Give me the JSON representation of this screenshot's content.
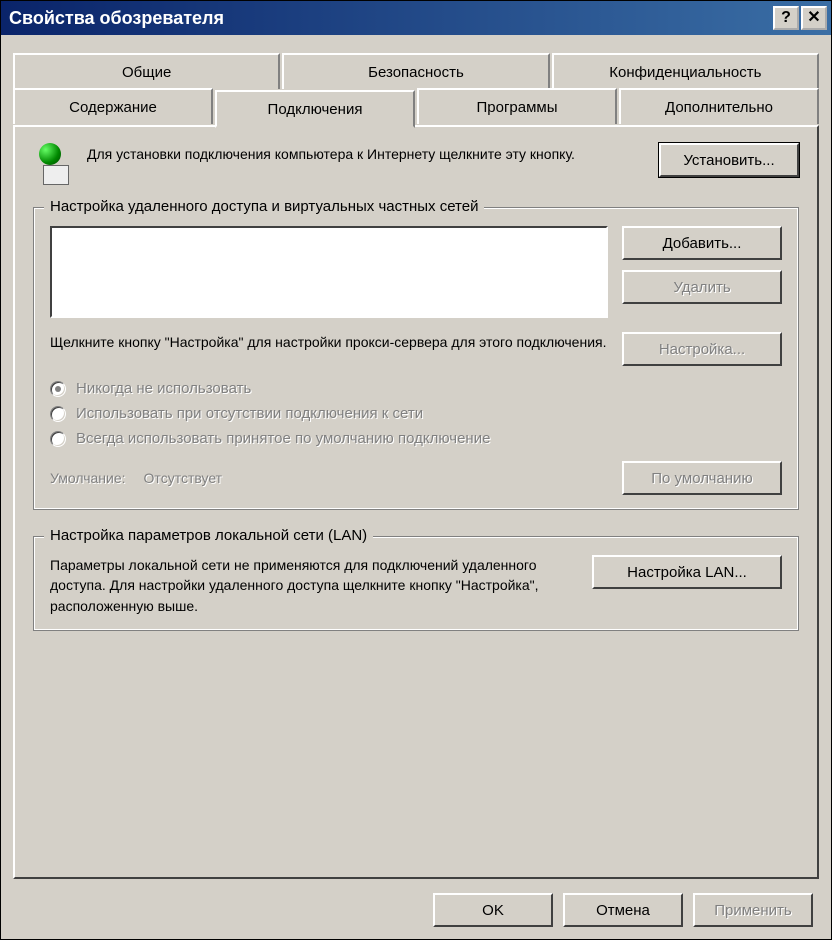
{
  "window": {
    "title": "Свойства обозревателя"
  },
  "tabs": {
    "row1": [
      {
        "id": "general",
        "label": "Общие"
      },
      {
        "id": "security",
        "label": "Безопасность"
      },
      {
        "id": "privacy",
        "label": "Конфиденциальность"
      }
    ],
    "row2": [
      {
        "id": "content",
        "label": "Содержание"
      },
      {
        "id": "connections",
        "label": "Подключения",
        "active": true
      },
      {
        "id": "programs",
        "label": "Программы"
      },
      {
        "id": "advanced",
        "label": "Дополнительно"
      }
    ]
  },
  "setup": {
    "text": "Для установки подключения компьютера к Интернету щелкните эту кнопку.",
    "button": "Установить..."
  },
  "dialup_group": {
    "legend": "Настройка удаленного доступа и виртуальных частных сетей",
    "add_btn": "Добавить...",
    "remove_btn": "Удалить",
    "settings_btn": "Настройка...",
    "hint": "Щелкните кнопку \"Настройка\" для настройки прокси-сервера для этого подключения.",
    "radios": [
      {
        "id": "never",
        "label": "Никогда не использовать",
        "checked": true
      },
      {
        "id": "whenno",
        "label": "Использовать при отсутствии подключения к сети"
      },
      {
        "id": "always",
        "label": "Всегда использовать принятое по умолчанию подключение"
      }
    ],
    "default_label": "Умолчание:",
    "default_value": "Отсутствует",
    "default_btn": "По умолчанию"
  },
  "lan_group": {
    "legend": "Настройка параметров локальной сети (LAN)",
    "text": "Параметры локальной сети не применяются для подключений удаленного доступа. Для настройки удаленного доступа щелкните кнопку \"Настройка\", расположенную выше.",
    "button": "Настройка LAN..."
  },
  "dialog_buttons": {
    "ok": "OK",
    "cancel": "Отмена",
    "apply": "Применить"
  }
}
